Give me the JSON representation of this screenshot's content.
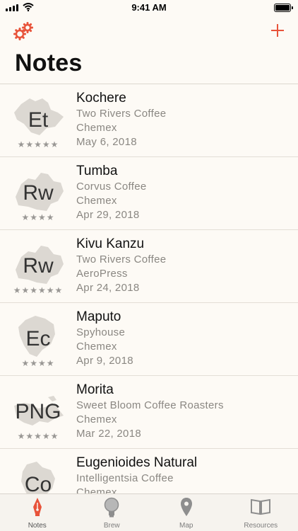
{
  "status": {
    "time": "9:41 AM"
  },
  "header": {
    "title": "Notes"
  },
  "notes": [
    {
      "abbr": "Et",
      "name": "Kochere",
      "roaster": "Two Rivers Coffee",
      "method": "Chemex",
      "date": "May 6, 2018",
      "stars": "★★★★★"
    },
    {
      "abbr": "Rw",
      "name": "Tumba",
      "roaster": "Corvus Coffee",
      "method": "Chemex",
      "date": "Apr 29, 2018",
      "stars": "★★★★"
    },
    {
      "abbr": "Rw",
      "name": "Kivu Kanzu",
      "roaster": "Two Rivers Coffee",
      "method": "AeroPress",
      "date": "Apr 24, 2018",
      "stars": "★★★★★★"
    },
    {
      "abbr": "Ec",
      "name": "Maputo",
      "roaster": "Spyhouse",
      "method": "Chemex",
      "date": "Apr 9, 2018",
      "stars": "★★★★"
    },
    {
      "abbr": "PNG",
      "name": "Morita",
      "roaster": "Sweet Bloom Coffee Roasters",
      "method": "Chemex",
      "date": "Mar 22, 2018",
      "stars": "★★★★★"
    },
    {
      "abbr": "Co",
      "name": "Eugenioides Natural",
      "roaster": "Intelligentsia Coffee",
      "method": "Chemex",
      "date": "",
      "stars": ""
    }
  ],
  "tabs": [
    {
      "label": "Notes"
    },
    {
      "label": "Brew"
    },
    {
      "label": "Map"
    },
    {
      "label": "Resources"
    }
  ],
  "colors": {
    "accent": "#e8533a",
    "tab_inactive": "#8e8e8e",
    "map_shape": "#dcd8d2"
  }
}
